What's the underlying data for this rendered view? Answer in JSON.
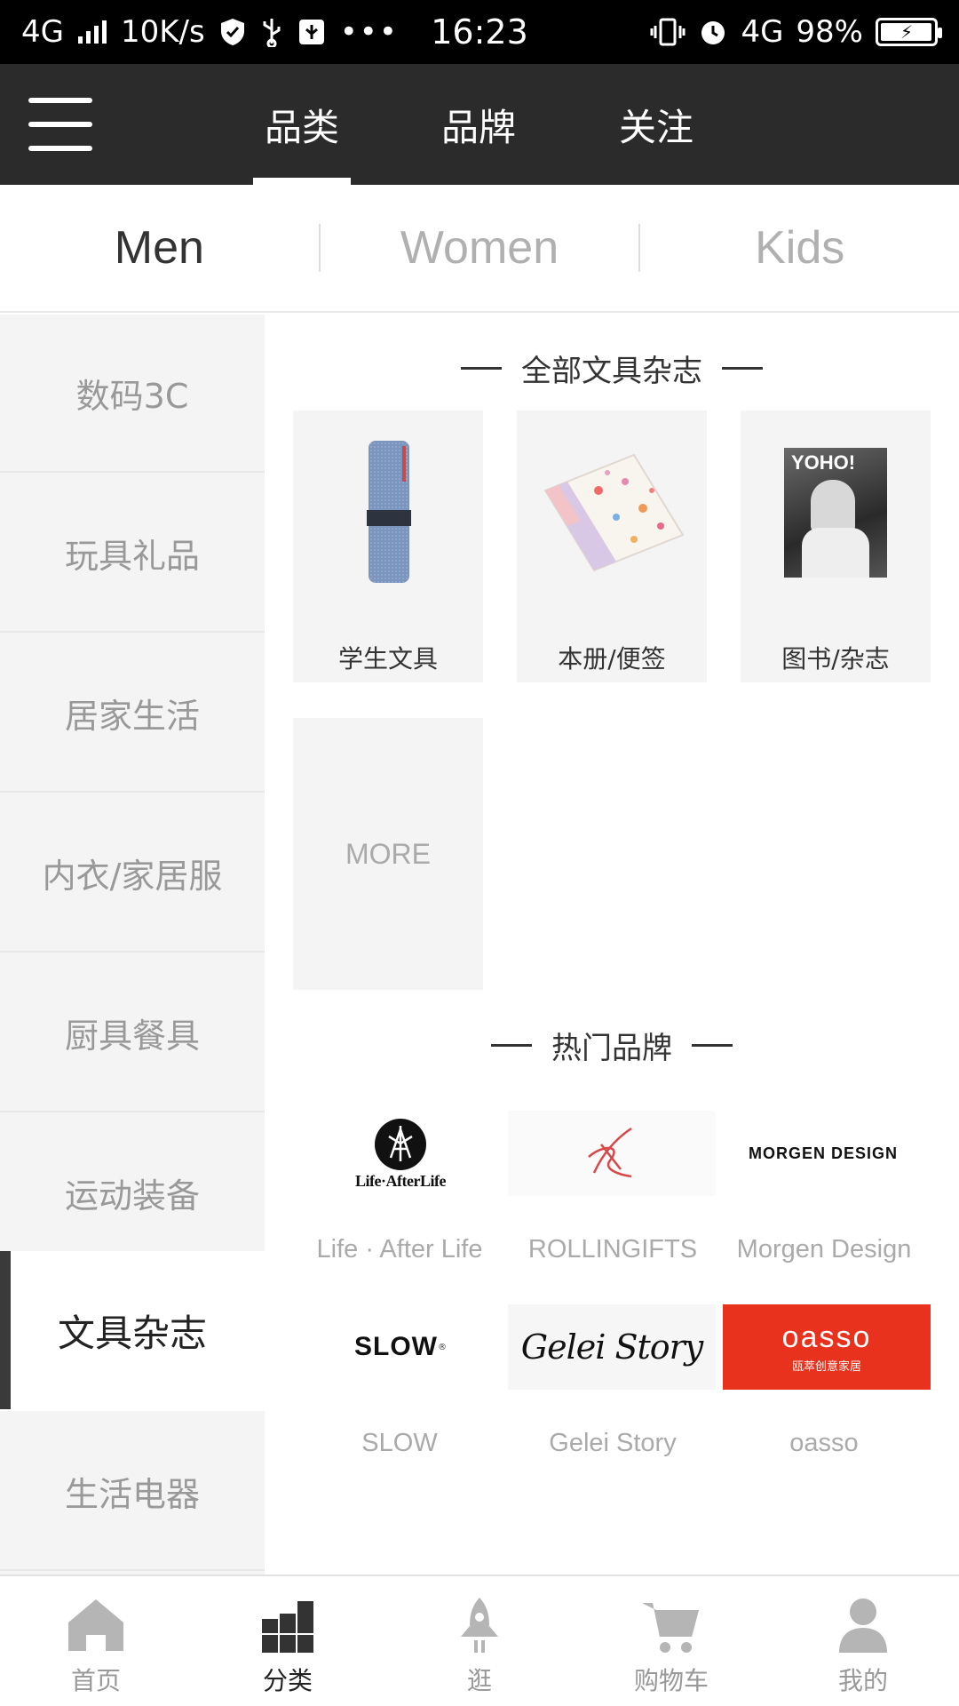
{
  "status_bar": {
    "network": "4G",
    "speed": "10K/s",
    "time": "16:23",
    "data_type": "4G",
    "battery": "98%",
    "battery_level": 0.98
  },
  "top_nav": {
    "tabs": [
      {
        "label": "品类",
        "active": true
      },
      {
        "label": "品牌",
        "active": false
      },
      {
        "label": "关注",
        "active": false
      }
    ]
  },
  "gender_tabs": [
    {
      "label": "Men",
      "active": true
    },
    {
      "label": "Women",
      "active": false
    },
    {
      "label": "Kids",
      "active": false
    }
  ],
  "sidebar": {
    "items": [
      {
        "label": "数码3C",
        "active": false
      },
      {
        "label": "玩具礼品",
        "active": false
      },
      {
        "label": "居家生活",
        "active": false
      },
      {
        "label": "内衣/家居服",
        "active": false
      },
      {
        "label": "厨具餐具",
        "active": false
      },
      {
        "label": "运动装备",
        "active": false
      },
      {
        "label": "文具杂志",
        "active": true
      },
      {
        "label": "生活电器",
        "active": false
      }
    ]
  },
  "main": {
    "category_section_title": "全部文具杂志",
    "categories": [
      {
        "label": "学生文具"
      },
      {
        "label": "本册/便签"
      },
      {
        "label": "图书/杂志"
      }
    ],
    "more_label": "MORE",
    "brand_section_title": "热门品牌",
    "brands": [
      {
        "name": "Life · After Life",
        "logo_text": "Life·AfterLife"
      },
      {
        "name": "ROLLINGIFTS",
        "logo_text": ""
      },
      {
        "name": "Morgen Design",
        "logo_text": "MORGEN DESIGN"
      },
      {
        "name": "SLOW",
        "logo_text": "SLOW"
      },
      {
        "name": "Gelei Story",
        "logo_text": "Gelei Story"
      },
      {
        "name": "oasso",
        "logo_text": "oasso",
        "logo_subtext": "瓯萃创意家居",
        "logo_bg": "#e8321e"
      }
    ],
    "magazine_cover_text": "YOHO!"
  },
  "tab_bar": {
    "items": [
      {
        "label": "首页",
        "icon": "home-icon",
        "active": false
      },
      {
        "label": "分类",
        "icon": "category-icon",
        "active": true
      },
      {
        "label": "逛",
        "icon": "rocket-icon",
        "active": false
      },
      {
        "label": "购物车",
        "icon": "cart-icon",
        "active": false
      },
      {
        "label": "我的",
        "icon": "profile-icon",
        "active": false
      }
    ]
  },
  "colors": {
    "nav_bg": "#2b2b2b",
    "sidebar_bg": "#f4f4f4",
    "active_accent": "#3a3a3a",
    "oasso_red": "#e8321e"
  }
}
